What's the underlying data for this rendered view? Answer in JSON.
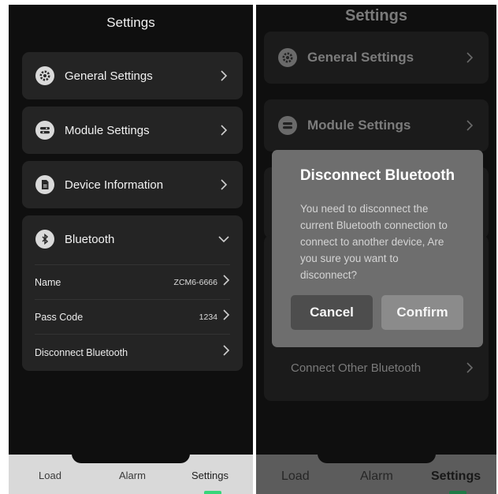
{
  "left": {
    "title": "Settings",
    "menu": [
      {
        "label": "General Settings",
        "icon": "gear-icon"
      },
      {
        "label": "Module Settings",
        "icon": "toggle-icon"
      },
      {
        "label": "Device Information",
        "icon": "document-icon"
      }
    ],
    "bluetooth": {
      "label": "Bluetooth",
      "icon": "bluetooth-icon",
      "rows": [
        {
          "label": "Name",
          "value": "ZCM6-6666"
        },
        {
          "label": "Pass Code",
          "value": "1234"
        },
        {
          "label": "Disconnect Bluetooth",
          "value": ""
        }
      ]
    },
    "tabs": [
      {
        "label": "Load"
      },
      {
        "label": "Alarm"
      },
      {
        "label": "Settings",
        "active": true
      }
    ]
  },
  "right": {
    "title": "Settings",
    "menu": [
      {
        "label": "General Settings",
        "icon": "gear-icon"
      },
      {
        "label": "Module Settings",
        "icon": "toggle-icon"
      }
    ],
    "connect_other": "Connect Other Bluetooth",
    "dialog": {
      "title": "Disconnect Bluetooth",
      "message": "You need to disconnect the current Bluetooth connection to connect to another device, Are you sure you want to disconnect?",
      "cancel": "Cancel",
      "confirm": "Confirm"
    },
    "tabs": [
      {
        "label": "Load"
      },
      {
        "label": "Alarm"
      },
      {
        "label": "Settings",
        "active": true
      }
    ]
  },
  "colors": {
    "background": "#0f0f0f",
    "card": "#242424",
    "tab_bar": "#d9d9d9",
    "tab_indicator": "#37d67a",
    "dialog": "#6e6e6e"
  }
}
